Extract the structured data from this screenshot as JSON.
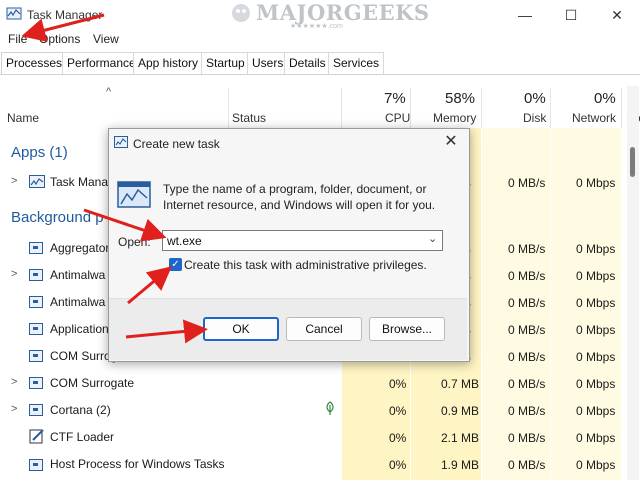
{
  "window": {
    "title": "Task Manager",
    "minimize": "—",
    "maximize": "☐",
    "close": "✕"
  },
  "watermark": {
    "text": "MAJORGEEKS",
    "sub": "★★★★★★.com"
  },
  "menu": [
    "File",
    "Options",
    "View"
  ],
  "tabs": [
    "Processes",
    "Performance",
    "App history",
    "Startup",
    "Users",
    "Details",
    "Services"
  ],
  "columns": {
    "name": "Name",
    "status": "Status",
    "cpu": {
      "pct": "7%",
      "label": "CPU"
    },
    "memory": {
      "pct": "58%",
      "label": "Memory"
    },
    "disk": {
      "pct": "0%",
      "label": "Disk"
    },
    "network": {
      "pct": "0%",
      "label": "Network"
    },
    "power": {
      "label": "Po"
    }
  },
  "groups": {
    "apps": "Apps (1)",
    "background": "Background p"
  },
  "rows": [
    {
      "name": "Task Manag",
      "disk": "0 MB/s",
      "net": "0 Mbps",
      "mem": "B"
    },
    {
      "name": "Aggregator",
      "disk": "0 MB/s",
      "net": "0 Mbps",
      "mem": "B"
    },
    {
      "name": "Antimalwa",
      "disk": "0 MB/s",
      "net": "0 Mbps",
      "mem": "B"
    },
    {
      "name": "Antimalwa",
      "disk": "0 MB/s",
      "net": "0 Mbps",
      "mem": "B"
    },
    {
      "name": "Application",
      "disk": "0 MB/s",
      "net": "0 Mbps",
      "mem": "B"
    },
    {
      "name": "COM Surrog",
      "disk": "0 MB/s",
      "net": "0 Mbps",
      "mem": "B"
    },
    {
      "name": "COM Surrogate",
      "cpu": "0%",
      "mem": "0.7 MB",
      "disk": "0 MB/s",
      "net": "0 Mbps"
    },
    {
      "name": "Cortana (2)",
      "cpu": "0%",
      "mem": "0.9 MB",
      "disk": "0 MB/s",
      "net": "0 Mbps"
    },
    {
      "name": "CTF Loader",
      "cpu": "0%",
      "mem": "2.1 MB",
      "disk": "0 MB/s",
      "net": "0 Mbps"
    },
    {
      "name": "Host Process for Windows Tasks",
      "cpu": "0%",
      "mem": "1.9 MB",
      "disk": "0 MB/s",
      "net": "0 Mbps"
    }
  ],
  "dialog": {
    "title": "Create new task",
    "close": "✕",
    "text": "Type the name of a program, folder, document, or Internet resource, and Windows will open it for you.",
    "open_label": "Open:",
    "open_value": "wt.exe",
    "checkbox_label": "Create this task with administrative privileges.",
    "checkbox_checked": true,
    "ok": "OK",
    "cancel": "Cancel",
    "browse": "Browse..."
  },
  "colors": {
    "accent": "#1e66c9",
    "heat": "#fff4c4",
    "arrow": "#e0201c",
    "group": "#1e5b9c"
  }
}
